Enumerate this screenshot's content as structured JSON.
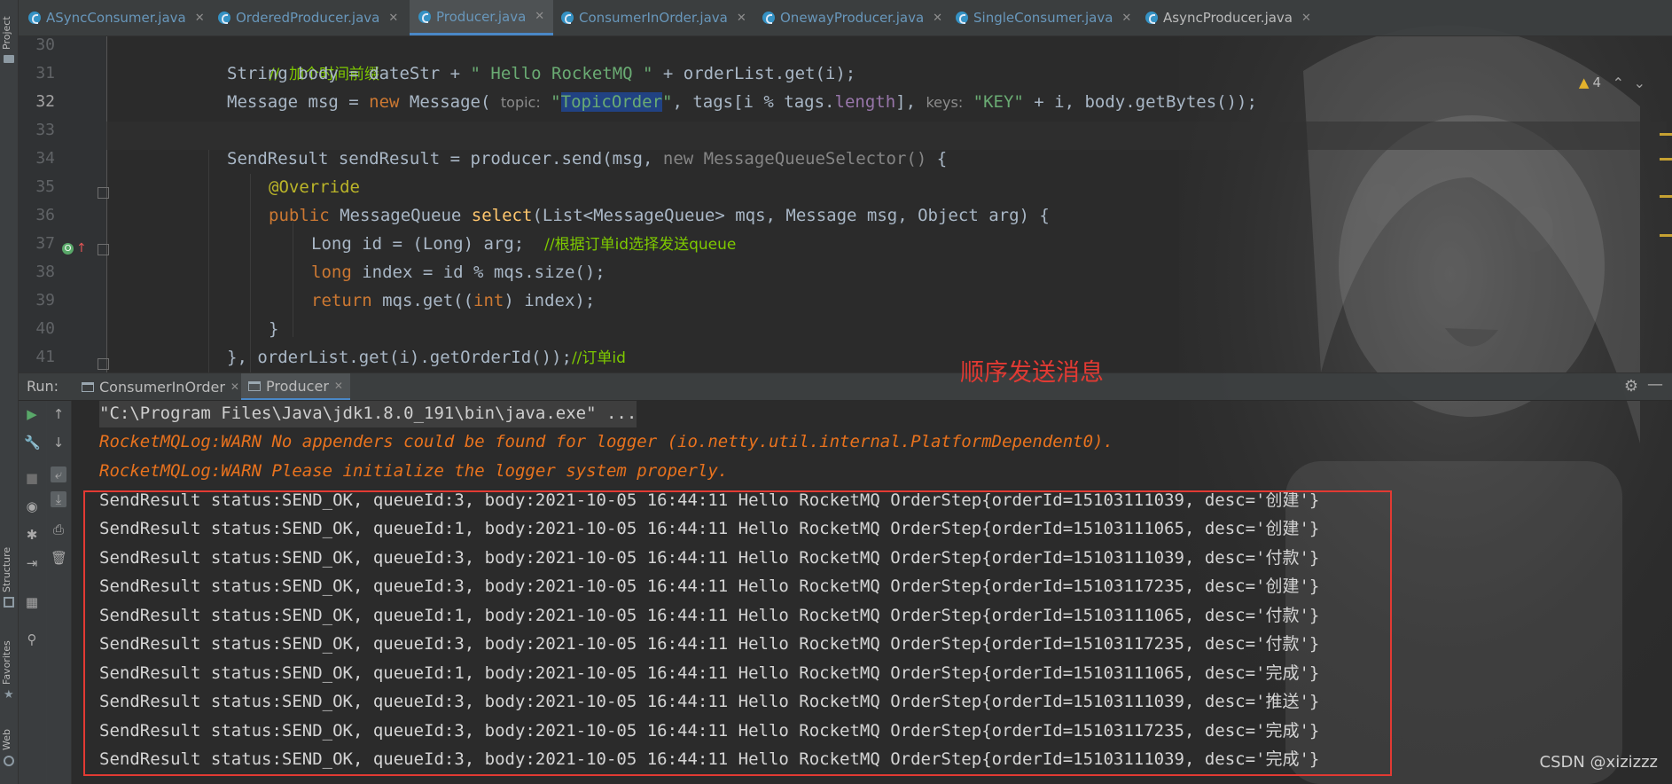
{
  "tabs": [
    {
      "label": "ASyncConsumer.java",
      "active": false
    },
    {
      "label": "OrderedProducer.java",
      "active": false
    },
    {
      "label": "Producer.java",
      "active": true
    },
    {
      "label": "ConsumerInOrder.java",
      "active": false
    },
    {
      "label": "OnewayProducer.java",
      "active": false
    },
    {
      "label": "SingleConsumer.java",
      "active": false
    },
    {
      "label": "AsyncProducer.java",
      "active": false
    }
  ],
  "left_strip": {
    "project": "Project",
    "structure": "Structure",
    "favorites": "Favorites",
    "web": "Web"
  },
  "editor": {
    "line_numbers": [
      "30",
      "31",
      "32",
      "33",
      "34",
      "35",
      "36",
      "37",
      "38",
      "39",
      "40",
      "41"
    ],
    "current_line": "32",
    "warnings_count": "4",
    "line30_comment": "//  加个时间前缀",
    "line31_a": "String body = dateStr + ",
    "line31_str": "\" Hello RocketMQ \"",
    "line31_b": " + orderList.get(i);",
    "line32_a": "Message msg = ",
    "line32_new": "new",
    "line32_b": " Message( ",
    "line32_hint1": "topic:",
    "line32_q1": " \"",
    "line32_topic": "TopicOrder",
    "line32_q2": "\"",
    "line32_c": ", tags[i % tags.",
    "line32_length": "length",
    "line32_d": "], ",
    "line32_hint2": "keys:",
    "line32_key": " \"KEY\"",
    "line32_e": " + i, body.getBytes());",
    "line34_a": "SendResult sendResult = producer.send(msg, ",
    "line34_new": "new MessageQueueSelector()",
    "line34_b": " {",
    "line35_annot": "@Override",
    "line36_kw": "public",
    "line36_a": " MessageQueue ",
    "line36_fn": "select",
    "line36_b": "(List<MessageQueue> mqs, Message msg, Object arg) {",
    "line37_a": "Long id = (Long) arg;  ",
    "line37_comment": "//根据订单id选择发送queue",
    "line38_kw": "long",
    "line38_a": " index = id % mqs.size();",
    "line39_kw": "return",
    "line39_a": " mqs.get((",
    "line39_int": "int",
    "line39_b": ") index);",
    "line40": "}",
    "line41_a": "}, orderList.get(i).getOrderId());",
    "line41_comment": "//订单id"
  },
  "annotation_note": "顺序发送消息",
  "run": {
    "label": "Run:",
    "tabs": [
      {
        "label": "ConsumerInOrder",
        "active": false
      },
      {
        "label": "Producer",
        "active": true
      }
    ]
  },
  "console": {
    "command": "\"C:\\Program Files\\Java\\jdk1.8.0_191\\bin\\java.exe\" ...",
    "warnings": [
      "RocketMQLog:WARN No appenders could be found for logger (io.netty.util.internal.PlatformDependent0).",
      "RocketMQLog:WARN Please initialize the logger system properly."
    ],
    "results": [
      "SendResult status:SEND_OK, queueId:3, body:2021-10-05 16:44:11 Hello RocketMQ OrderStep{orderId=15103111039, desc='创建'}",
      "SendResult status:SEND_OK, queueId:1, body:2021-10-05 16:44:11 Hello RocketMQ OrderStep{orderId=15103111065, desc='创建'}",
      "SendResult status:SEND_OK, queueId:3, body:2021-10-05 16:44:11 Hello RocketMQ OrderStep{orderId=15103111039, desc='付款'}",
      "SendResult status:SEND_OK, queueId:3, body:2021-10-05 16:44:11 Hello RocketMQ OrderStep{orderId=15103117235, desc='创建'}",
      "SendResult status:SEND_OK, queueId:1, body:2021-10-05 16:44:11 Hello RocketMQ OrderStep{orderId=15103111065, desc='付款'}",
      "SendResult status:SEND_OK, queueId:3, body:2021-10-05 16:44:11 Hello RocketMQ OrderStep{orderId=15103117235, desc='付款'}",
      "SendResult status:SEND_OK, queueId:1, body:2021-10-05 16:44:11 Hello RocketMQ OrderStep{orderId=15103111065, desc='完成'}",
      "SendResult status:SEND_OK, queueId:3, body:2021-10-05 16:44:11 Hello RocketMQ OrderStep{orderId=15103111039, desc='推送'}",
      "SendResult status:SEND_OK, queueId:3, body:2021-10-05 16:44:11 Hello RocketMQ OrderStep{orderId=15103117235, desc='完成'}",
      "SendResult status:SEND_OK, queueId:3, body:2021-10-05 16:44:11 Hello RocketMQ OrderStep{orderId=15103111039, desc='完成'}"
    ]
  },
  "watermark": "CSDN @xizizzz",
  "colors": {
    "annotation_red": "#e23a33",
    "accent_blue": "#4a88c7",
    "warn_orange": "#e8721e"
  }
}
